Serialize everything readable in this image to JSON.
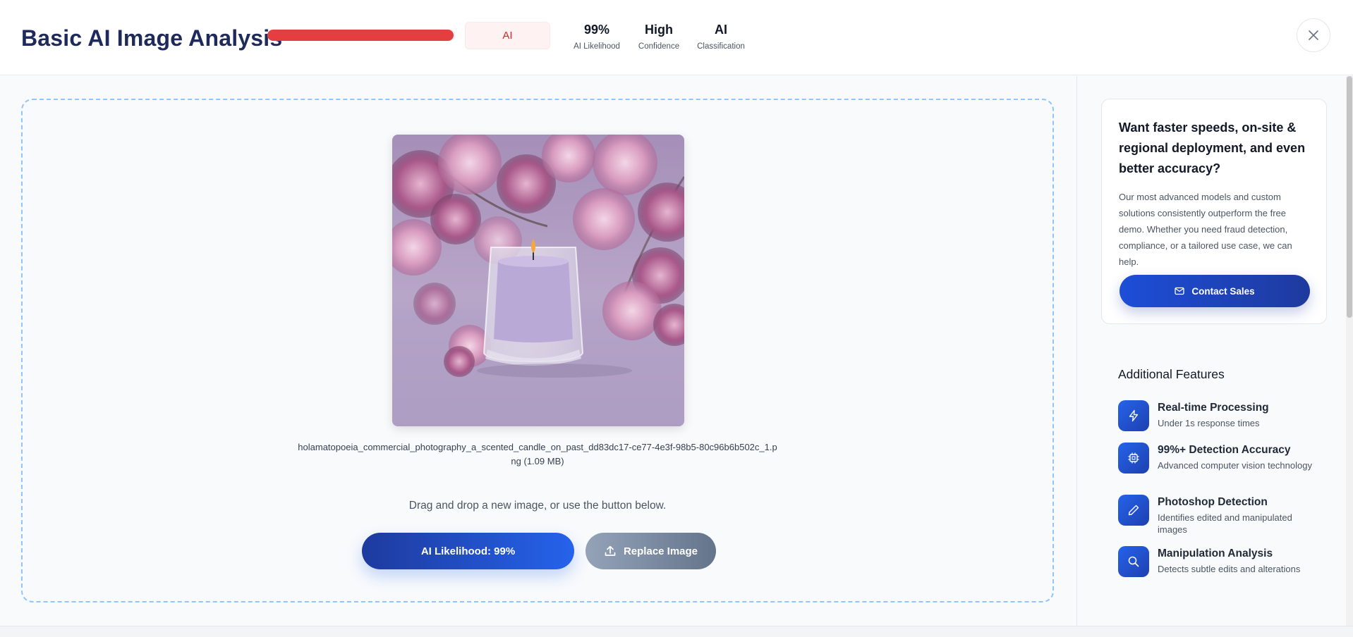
{
  "header": {
    "title": "Basic AI Image Analysis",
    "progress_fraction": 0.99,
    "progress_color": "#e53e3e",
    "classification_chip": "AI",
    "stats": [
      {
        "value": "99%",
        "label": "AI Likelihood"
      },
      {
        "value": "High",
        "label": "Confidence"
      },
      {
        "value": "AI",
        "label": "Classification"
      }
    ],
    "close_icon": "close-icon"
  },
  "main": {
    "filename": "holamatopoeia_commercial_photography_a_scented_candle_on_past_dd83dc17-ce77-4e3f-98b5-80c96b6b502c_1.png (1.09 MB)",
    "drag_text": "Drag and drop a new image, or use the button below.",
    "likelihood_button": "AI Likelihood: 99%",
    "replace_button": "Replace Image",
    "replace_icon": "upload-icon"
  },
  "sidebar": {
    "promo": {
      "title": "Want faster speeds, on-site & regional deployment, and even better accuracy?",
      "text": "Our most advanced models and custom solutions consistently outperform the free demo. Whether you need fraud detection, compliance, or a tailored use case, we can help.",
      "button": "Contact Sales",
      "button_icon": "mail-icon"
    },
    "features_title": "Additional Features",
    "features": [
      {
        "name": "Real-time Processing",
        "desc": "Under 1s response times",
        "icon": "lightning-icon"
      },
      {
        "name": "99%+ Detection Accuracy",
        "desc": "Advanced computer vision technology",
        "icon": "chip-icon"
      },
      {
        "name": "Photoshop Detection",
        "desc": "Identifies edited and manipulated images",
        "icon": "pencil-icon"
      },
      {
        "name": "Manipulation Analysis",
        "desc": "Detects subtle edits and alterations",
        "icon": "search-icon"
      }
    ]
  },
  "colors": {
    "accent": "#1e3a9e",
    "danger": "#e53e3e",
    "dropzone_border": "#93c5fd"
  }
}
